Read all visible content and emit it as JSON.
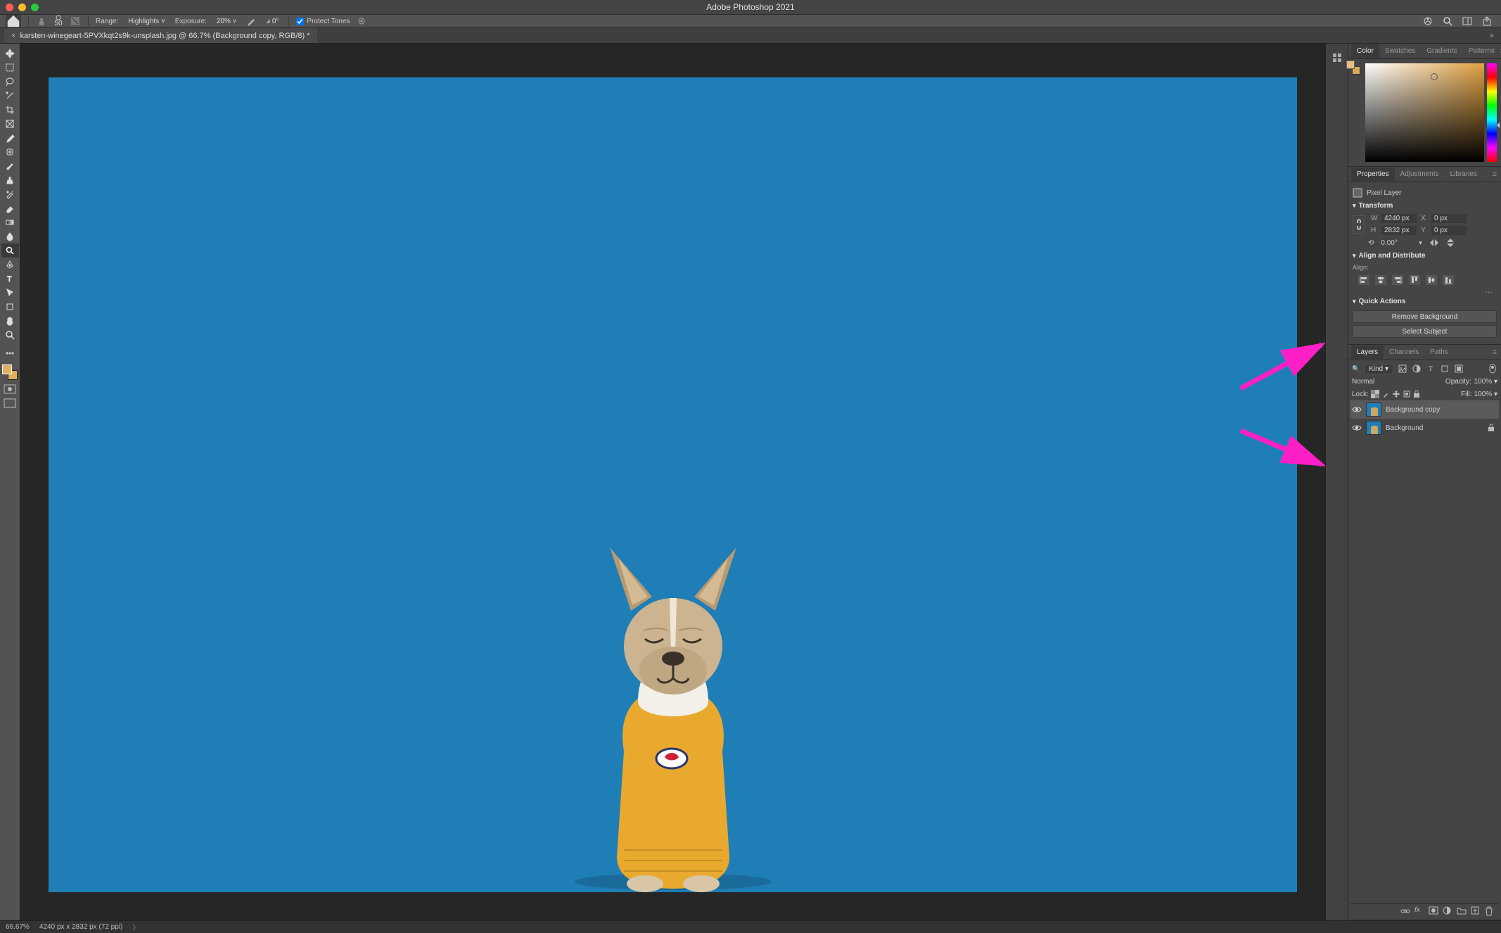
{
  "app_title": "Adobe Photoshop 2021",
  "options_bar": {
    "brush_size": "50",
    "range_label": "Range:",
    "range_value": "Highlights",
    "exposure_label": "Exposure:",
    "exposure_value": "20%",
    "angle_label": "⦨",
    "angle_value": "0°",
    "protect_tones_label": "Protect Tones"
  },
  "document": {
    "tab_label": "karsten-winegeart-5PVXkqt2s9k-unsplash.jpg @ 66.7% (Background copy, RGB/8) *"
  },
  "color_panel": {
    "tabs": [
      "Color",
      "Swatches",
      "Gradients",
      "Patterns"
    ],
    "active": "Color"
  },
  "properties_panel": {
    "tabs": [
      "Properties",
      "Adjustments",
      "Libraries"
    ],
    "active": "Properties",
    "layer_type_label": "Pixel Layer",
    "transform_label": "Transform",
    "w_label": "W",
    "w_value": "4240 px",
    "h_label": "H",
    "h_value": "2832 px",
    "x_label": "X",
    "x_value": "0 px",
    "y_label": "Y",
    "y_value": "0 px",
    "rotate_value": "0.00°",
    "align_label": "Align and Distribute",
    "align_sub": "Align:",
    "quick_actions_label": "Quick Actions",
    "remove_bg_label": "Remove Background",
    "select_subject_label": "Select Subject",
    "more": "…"
  },
  "layers_panel": {
    "tabs": [
      "Layers",
      "Channels",
      "Paths"
    ],
    "active": "Layers",
    "filter_label": "Kind",
    "blend_mode": "Normal",
    "opacity_label": "Opacity:",
    "opacity_value": "100%",
    "lock_label": "Lock:",
    "fill_label": "Fill:",
    "fill_value": "100%",
    "layers": [
      {
        "name": "Background copy",
        "visible": true,
        "locked": false,
        "selected": true
      },
      {
        "name": "Background",
        "visible": true,
        "locked": true,
        "selected": false
      }
    ]
  },
  "status_bar": {
    "zoom": "66.67%",
    "doc_info": "4240 px x 2832 px (72 ppi)"
  },
  "icons": {
    "search": "Q"
  }
}
